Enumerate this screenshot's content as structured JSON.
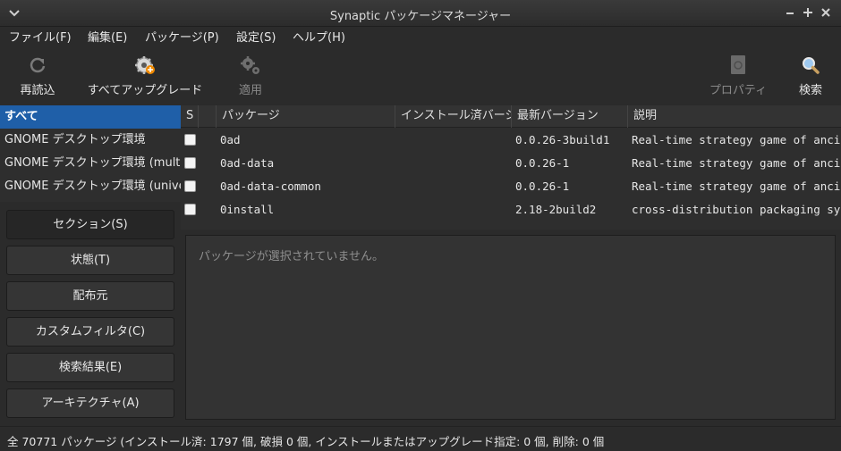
{
  "window": {
    "title": "Synaptic パッケージマネージャー"
  },
  "menubar": {
    "items": [
      "ファイル(F)",
      "編集(E)",
      "パッケージ(P)",
      "設定(S)",
      "ヘルプ(H)"
    ]
  },
  "toolbar": {
    "reload_label": "再読込",
    "upgrade_all_label": "すべてアップグレード",
    "apply_label": "適用",
    "properties_label": "プロパティ",
    "search_label": "検索"
  },
  "sidebar": {
    "filters": [
      "すべて",
      "GNOME デスクトップ環境",
      "GNOME デスクトップ環境 (multiverse)",
      "GNOME デスクトップ環境 (universe)"
    ],
    "buttons": [
      "セクション(S)",
      "状態(T)",
      "配布元",
      "カスタムフィルタ(C)",
      "検索結果(E)",
      "アーキテクチャ(A)"
    ]
  },
  "package_list": {
    "columns": [
      "S",
      "パッケージ",
      "インストール済バージョン",
      "最新バージョン",
      "説明"
    ],
    "rows": [
      {
        "name": "0ad",
        "installed": "",
        "latest": "0.0.26-3build1",
        "description": "Real-time strategy game of ancient warfare"
      },
      {
        "name": "0ad-data",
        "installed": "",
        "latest": "0.0.26-1",
        "description": "Real-time strategy game of ancient warfare (data files)"
      },
      {
        "name": "0ad-data-common",
        "installed": "",
        "latest": "0.0.26-1",
        "description": "Real-time strategy game of ancient warfare (common data files)"
      },
      {
        "name": "0install",
        "installed": "",
        "latest": "2.18-2build2",
        "description": "cross-distribution packaging system"
      }
    ]
  },
  "details": {
    "message": "パッケージが選択されていません。"
  },
  "statusbar": {
    "text": "全 70771 パッケージ (インストール済: 1797 個, 破損 0 個, インストールまたはアップグレード指定: 0 個, 削除: 0 個"
  }
}
